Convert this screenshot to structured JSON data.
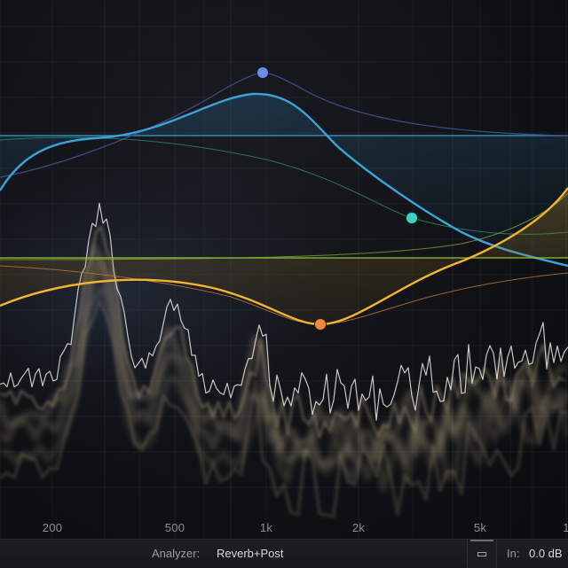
{
  "freq_axis": {
    "labels": [
      "200",
      "500",
      "1k",
      "2k",
      "5k",
      "1"
    ],
    "hz": [
      200,
      500,
      1000,
      2000,
      5000,
      10000
    ],
    "range_hz": [
      100,
      10000
    ]
  },
  "bands": [
    {
      "name": "band-1",
      "type": "bell",
      "color": "#6b8fe8",
      "freq_hz": 950,
      "gain": 2.0
    },
    {
      "name": "band-2",
      "type": "bell",
      "color": "#3fd1c4",
      "freq_hz": 3000
    },
    {
      "name": "band-3",
      "type": "bell",
      "color": "#f0893f",
      "freq_hz": 1500
    },
    {
      "name": "band-4",
      "type": "high-shelf",
      "color": "#f2c840"
    }
  ],
  "colors": {
    "accent_blue": "#3aa3d8",
    "accent_yellow": "#f2b52e",
    "analyzer": "#e8d2a4",
    "green_line": "#8fc23a"
  },
  "bottom_bar": {
    "analyzer_label": "Analyzer:",
    "analyzer_value": "Reverb+Post",
    "snap_icon": "▭",
    "input_label": "In:",
    "input_value": "0.0 dB"
  }
}
